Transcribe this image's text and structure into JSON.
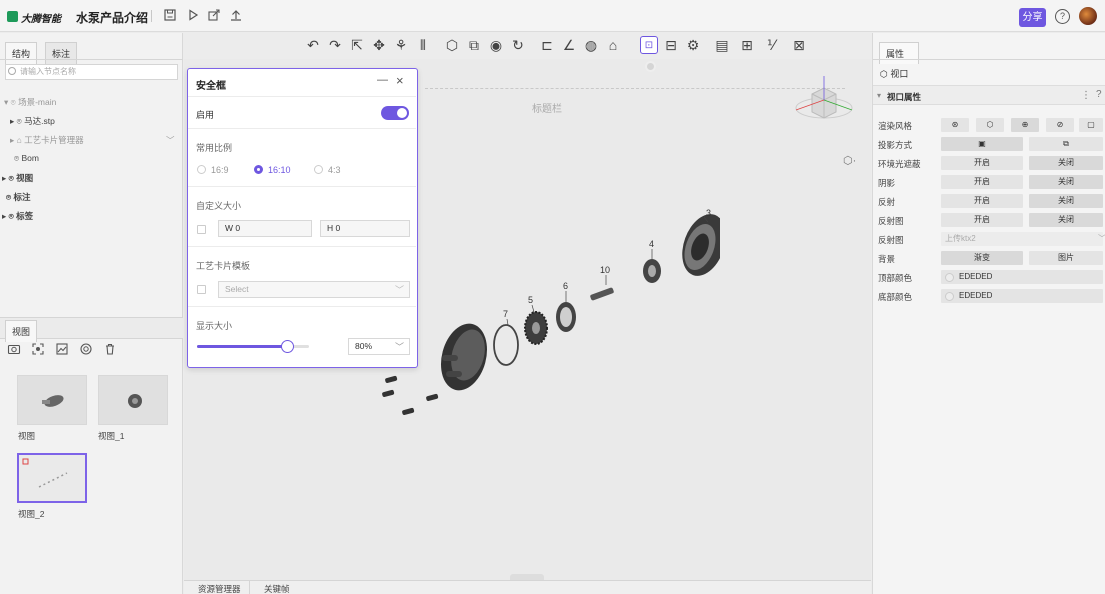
{
  "app": {
    "logo_text": "大腾智能",
    "title": "水泵产品介绍",
    "share_label": "分享",
    "help_icon": "help-icon"
  },
  "left_panel": {
    "tabs": [
      "结构",
      "标注"
    ],
    "search_placeholder": "请输入节点名称",
    "tree": [
      {
        "label": "场景-main"
      },
      {
        "label": "马达.stp"
      },
      {
        "label": "工艺卡片管理器"
      },
      {
        "label": "Bom"
      },
      {
        "label": "视图"
      },
      {
        "label": "标注"
      },
      {
        "label": "标签"
      }
    ],
    "views_tab": "视图",
    "views": [
      {
        "label": "视图"
      },
      {
        "label": "视图_1"
      },
      {
        "label": "视图_2"
      }
    ]
  },
  "canvas": {
    "title_bar_text": "标题栏",
    "part_numbers": [
      "3",
      "4",
      "5",
      "6",
      "7",
      "10"
    ],
    "bottom_tabs": [
      "资源管理器",
      "关键帧"
    ]
  },
  "dialog": {
    "title": "安全框",
    "minimize_label": "—",
    "close_label": "×",
    "enable_label": "启用",
    "enabled": true,
    "ratio_label": "常用比例",
    "ratios": [
      "16:9",
      "16:10",
      "4:3"
    ],
    "selected_ratio": "16:10",
    "custom_size_label": "自定义大小",
    "width_value": "W 0",
    "height_value": "H 0",
    "template_label": "工艺卡片模板",
    "template_placeholder": "Select",
    "display_size_label": "显示大小",
    "display_size_value": "80%",
    "display_size_fraction": 0.8
  },
  "right_panel": {
    "tab": "属性",
    "node_label": "视口",
    "section_title": "视口属性",
    "rows": [
      {
        "label": "渲染风格"
      },
      {
        "label": "投影方式"
      },
      {
        "label": "环境光遮蔽",
        "on": "开启",
        "off": "关闭"
      },
      {
        "label": "阴影",
        "on": "开启",
        "off": "关闭"
      },
      {
        "label": "反射",
        "on": "开启",
        "off": "关闭"
      },
      {
        "label": "反射图",
        "on": "开启",
        "off": "关闭"
      },
      {
        "label": "反射图",
        "placeholder": "上传ktx2"
      },
      {
        "label": "背景",
        "on": "渐变",
        "off": "图片"
      },
      {
        "label": "顶部颜色",
        "color_text": "EDEDED"
      },
      {
        "label": "底部颜色",
        "color_text": "EDEDED"
      }
    ]
  },
  "colors": {
    "accent": "#6e57e0",
    "logo": "#1e9a5a"
  }
}
